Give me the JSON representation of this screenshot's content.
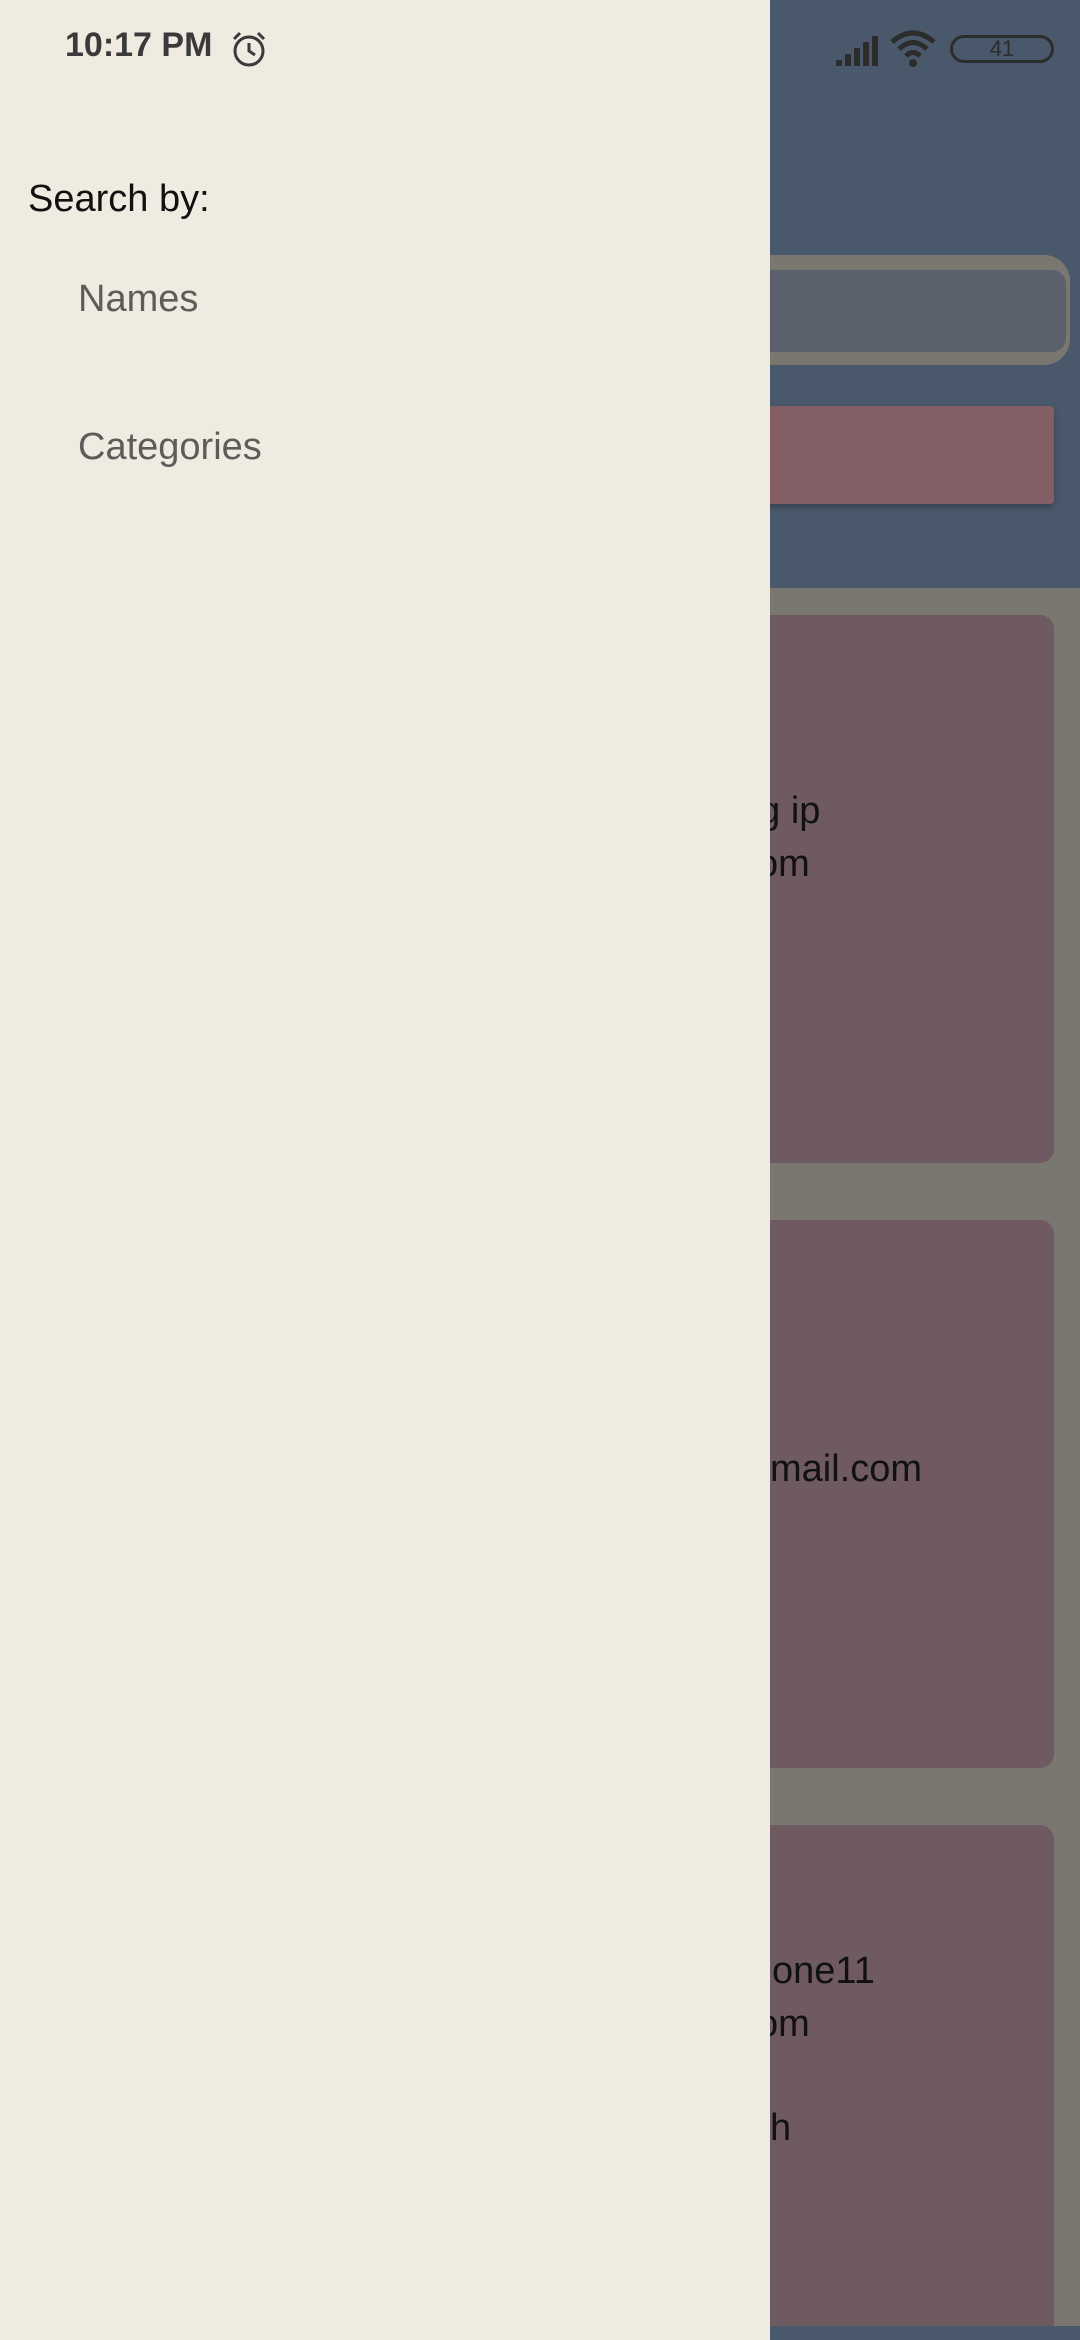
{
  "status_bar": {
    "time": "10:17 PM",
    "battery": "41",
    "icons": [
      "alarm-icon",
      "signal-icon",
      "wifi-icon",
      "battery-icon"
    ]
  },
  "drawer": {
    "title": "Search by:",
    "items": [
      {
        "label": "Names"
      },
      {
        "label": "Categories"
      }
    ]
  },
  "background_cards": [
    {
      "lines": [
        "ng ip",
        "com"
      ]
    },
    {
      "lines": [
        "mail.com"
      ]
    },
    {
      "lines": [
        "one11",
        "com",
        "h"
      ]
    }
  ],
  "colors": {
    "drawer_bg": "#efebe1",
    "header_bg": "#49586b",
    "card_bg": "#6e5a60",
    "button_bg": "#835e65",
    "scrim": "#7a7771"
  }
}
